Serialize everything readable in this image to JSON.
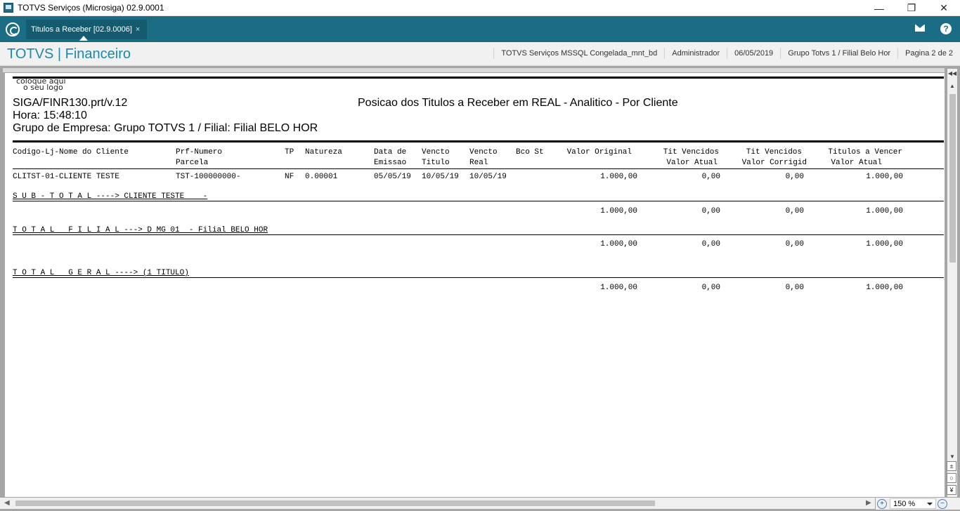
{
  "window": {
    "title": "TOTVS Serviços (Microsiga) 02.9.0001",
    "minimize": "—",
    "restore": "❐",
    "close": "✕"
  },
  "tabbar": {
    "tab_label": "Titulos a Receber [02.9.0006]",
    "tab_close": "×",
    "help": "?"
  },
  "header": {
    "brand": "TOTVS | Financeiro",
    "environment": "TOTVS Serviços MSSQL Congelada_mnt_bd",
    "user": "Administrador",
    "date": "06/05/2019",
    "company": "Grupo Totvs 1 / Filial Belo Hor",
    "pagination": "Pagina 2 de 2"
  },
  "report": {
    "logo_line1": "coloque aqui",
    "logo_line2": "o seu logo",
    "program": "SIGA/FINR130.prt/v.12",
    "title": "Posicao dos Titulos a Receber em REAL - Analitico - Por Cliente",
    "time": "Hora: 15:48:10",
    "group": "Grupo de Empresa: Grupo TOTVS 1 / Filial: Filial BELO HOR",
    "columns": {
      "client": "Codigo-Lj-Nome do Cliente",
      "prf_line1": "Prf-Numero",
      "prf_line2": "Parcela",
      "tp": "TP",
      "natureza": "Natureza",
      "emissao_line1": "Data de",
      "emissao_line2": "Emissao",
      "vtit_line1": "Vencto",
      "vtit_line2": "Titulo",
      "vreal_line1": "Vencto",
      "vreal_line2": "Real",
      "bco_st": "Bco St",
      "valor_original": "Valor Original",
      "tv_atual_line1": "Tit Vencidos",
      "tv_atual_line2": "Valor Atual",
      "tv_corr_line1": "Tit Vencidos",
      "tv_corr_line2": "Valor Corrigid",
      "tav_line1": "Titulos a Vencer",
      "tav_line2": "Valor Atual"
    },
    "row": {
      "client": "CLITST-01-CLIENTE TESTE",
      "numero": "TST-100000000-",
      "tp": "NF",
      "natureza": "0.00001",
      "emissao": "05/05/19",
      "venc_titulo": "10/05/19",
      "venc_real": "10/05/19",
      "valor_original": "1.000,00",
      "tv_atual": "0,00",
      "tv_corrigido": "0,00",
      "a_vencer": "1.000,00"
    },
    "subtotal": {
      "label": "S U B - T O T A L ----> CLIENTE TESTE    -",
      "valor_original": "1.000,00",
      "tv_atual": "0,00",
      "tv_corrigido": "0,00",
      "a_vencer": "1.000,00"
    },
    "total_filial": {
      "label": "T O T A L   F I L I A L ---> D MG 01  - Filial BELO HOR",
      "valor_original": "1.000,00",
      "tv_atual": "0,00",
      "tv_corrigido": "0,00",
      "a_vencer": "1.000,00"
    },
    "total_geral": {
      "label": "T O T A L   G E R A L ----> (1 TITULO)",
      "valor_original": "1.000,00",
      "tv_atual": "0,00",
      "tv_corrigido": "0,00",
      "a_vencer": "1.000,00"
    }
  },
  "viewer": {
    "zoom": "150 %",
    "zoom_in": "+",
    "zoom_out": "−"
  },
  "icons": {
    "app": "app-window-icon",
    "home": "home-icon",
    "mail": "mail-icon",
    "help": "help-icon"
  }
}
